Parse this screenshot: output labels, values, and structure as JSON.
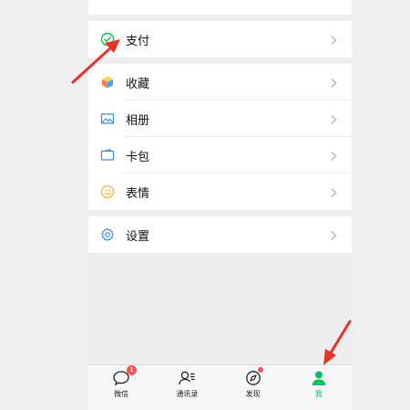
{
  "menu": {
    "pay": "支付",
    "favorites": "收藏",
    "album": "相册",
    "cards": "卡包",
    "stickers": "表情",
    "settings": "设置"
  },
  "tabbar": {
    "chats": "微信",
    "chats_badge": "1",
    "contacts": "通讯录",
    "discover": "发现",
    "me": "我"
  },
  "colors": {
    "accent": "#07c160",
    "badge": "#fa5151",
    "annotation_arrow": "#e8322a"
  }
}
